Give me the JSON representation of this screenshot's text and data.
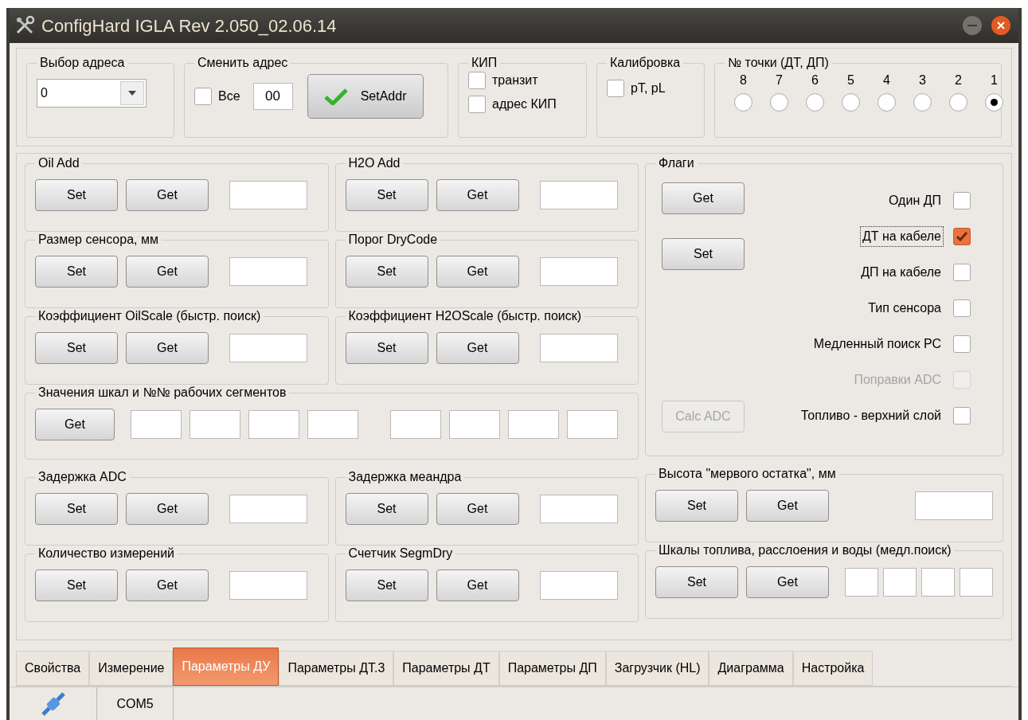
{
  "window": {
    "title": "ConfigHard IGLA Rev 2.050_02.06.14"
  },
  "address_select": {
    "label": "Выбор адреса",
    "value": "0"
  },
  "change_address": {
    "label": "Сменить адрес",
    "all": {
      "label": "Все",
      "checked": false
    },
    "value": "00",
    "button": "SetAddr"
  },
  "kip": {
    "label": "КИП",
    "options": [
      {
        "label": "транзит",
        "checked": false
      },
      {
        "label": "адрес КИП",
        "checked": false
      }
    ]
  },
  "calibration": {
    "label": "Калибровка",
    "option": {
      "label": "pT, pL",
      "checked": false
    }
  },
  "point": {
    "label": "№ точки (ДТ, ДП)",
    "radios": [
      {
        "label": "8",
        "selected": false
      },
      {
        "label": "7",
        "selected": false
      },
      {
        "label": "6",
        "selected": false
      },
      {
        "label": "5",
        "selected": false
      },
      {
        "label": "4",
        "selected": false
      },
      {
        "label": "3",
        "selected": false
      },
      {
        "label": "2",
        "selected": false
      },
      {
        "label": "1",
        "selected": true
      }
    ]
  },
  "rows": [
    {
      "kind": "pair",
      "groups": [
        {
          "title": "Oil Add",
          "buttons": [
            "Set",
            "Get"
          ]
        },
        {
          "title": "H2O Add",
          "buttons": [
            "Set",
            "Get"
          ]
        }
      ]
    },
    {
      "kind": "pair",
      "groups": [
        {
          "title": "Размер сенсора, мм",
          "buttons": [
            "Set",
            "Get"
          ]
        },
        {
          "title": "Порог DryCode",
          "buttons": [
            "Set",
            "Get"
          ]
        }
      ]
    },
    {
      "kind": "pair",
      "groups": [
        {
          "title": "Коэффициент OilScale (быстр. поиск)",
          "buttons": [
            "Set",
            "Get"
          ]
        },
        {
          "title": "Коэффициент H2OScale (быстр. поиск)",
          "buttons": [
            "Set",
            "Get"
          ]
        }
      ]
    },
    {
      "kind": "scales",
      "title": "Значения шкал и №№ рабочих сегментов",
      "buttons": [
        "Get"
      ]
    },
    {
      "kind": "pair",
      "groups": [
        {
          "title": "Задержка ADC",
          "buttons": [
            "Set",
            "Get"
          ]
        },
        {
          "title": "Задержка меандра",
          "buttons": [
            "Set",
            "Get"
          ]
        }
      ]
    },
    {
      "kind": "pair",
      "groups": [
        {
          "title": "Количество измерений",
          "buttons": [
            "Set",
            "Get"
          ]
        },
        {
          "title": "Счетчик SegmDry",
          "buttons": [
            "Set",
            "Get"
          ]
        }
      ]
    }
  ],
  "flags": {
    "title": "Флаги",
    "buttons": [
      {
        "label": "Get",
        "disabled": false
      },
      {
        "label": "Set",
        "disabled": false
      },
      {
        "label": "Calc ADC",
        "disabled": true
      }
    ],
    "options": [
      {
        "label": "Один ДП",
        "checked": false,
        "disabled": false,
        "focused": false
      },
      {
        "label": "ДТ на кабеле",
        "checked": true,
        "disabled": false,
        "focused": true
      },
      {
        "label": "ДП на кабеле",
        "checked": false,
        "disabled": false,
        "focused": false
      },
      {
        "label": "Тип сенсора",
        "checked": false,
        "disabled": false,
        "focused": false
      },
      {
        "label": "Медленный поиск РС",
        "checked": false,
        "disabled": false,
        "focused": false
      },
      {
        "label": "Поправки ADC",
        "checked": false,
        "disabled": true,
        "focused": false
      },
      {
        "label": "Топливо - верхний слой",
        "checked": false,
        "disabled": false,
        "focused": false
      }
    ]
  },
  "right_groups": [
    {
      "kind": "single",
      "title": "Высота \"мервого остатка\", мм",
      "buttons": [
        "Set",
        "Get"
      ]
    },
    {
      "kind": "quad",
      "title": "Шкалы топлива, расслоения и воды (медл.поиск)",
      "buttons": [
        "Set",
        "Get"
      ]
    }
  ],
  "tabs": [
    {
      "label": "Свойства",
      "selected": false
    },
    {
      "label": "Измерение",
      "selected": false
    },
    {
      "label": "Параметры ДУ",
      "selected": true
    },
    {
      "label": "Параметры ДТ.3",
      "selected": false
    },
    {
      "label": "Параметры ДТ",
      "selected": false
    },
    {
      "label": "Параметры ДП",
      "selected": false
    },
    {
      "label": "Загрузчик (HL)",
      "selected": false
    },
    {
      "label": "Диаграмма",
      "selected": false
    },
    {
      "label": "Настройка",
      "selected": false
    }
  ],
  "status_bar": {
    "port": "COM5"
  }
}
